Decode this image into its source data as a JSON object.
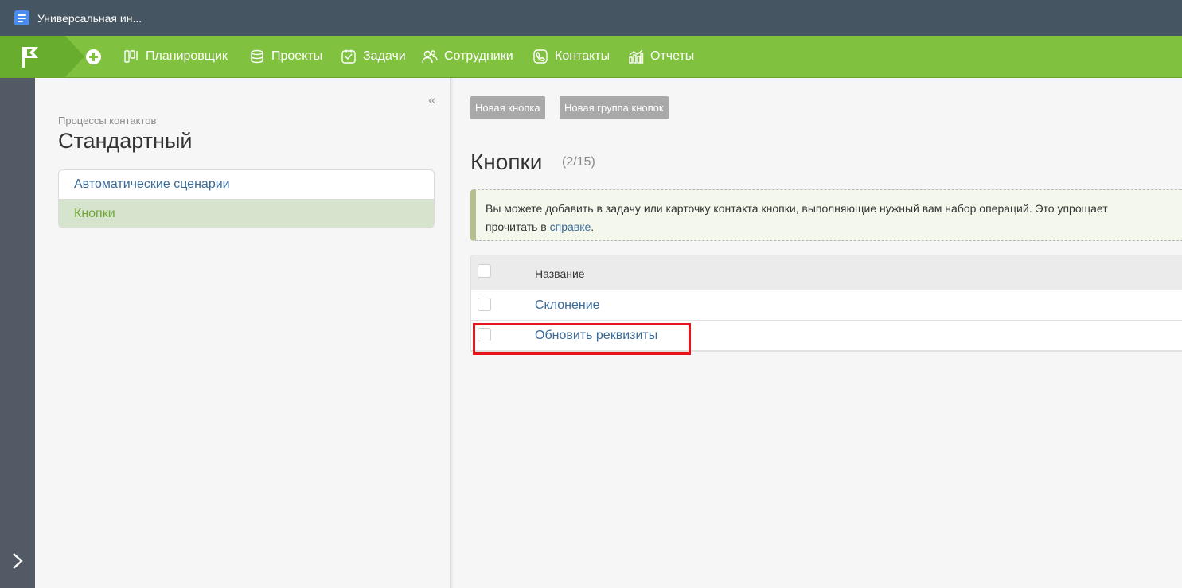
{
  "window": {
    "title": "Универсальная ин..."
  },
  "nav": {
    "items": [
      {
        "label": "Планировщик",
        "icon": "planner-icon"
      },
      {
        "label": "Проекты",
        "icon": "projects-icon"
      },
      {
        "label": "Задачи",
        "icon": "tasks-icon"
      },
      {
        "label": "Сотрудники",
        "icon": "employees-icon"
      },
      {
        "label": "Контакты",
        "icon": "contacts-icon"
      },
      {
        "label": "Отчеты",
        "icon": "reports-icon"
      }
    ]
  },
  "sidebar": {
    "subtitle": "Процессы контактов",
    "title": "Стандартный",
    "collapse_glyph": "«",
    "items": [
      {
        "label": "Автоматические сценарии",
        "active": false
      },
      {
        "label": "Кнопки",
        "active": true
      }
    ]
  },
  "main": {
    "buttons": {
      "new_button": "Новая кнопка",
      "new_group": "Новая группа кнопок"
    },
    "title": "Кнопки",
    "count": "(2/15)",
    "info": {
      "line1": "Вы можете добавить в задачу или карточку контакта кнопки, выполняющие нужный вам набор операций. Это упрощает",
      "line2_prefix": "прочитать в ",
      "link": "справке",
      "line2_suffix": "."
    },
    "table": {
      "header": "Название",
      "rows": [
        {
          "name": "Склонение"
        },
        {
          "name": "Обновить реквизиты"
        }
      ]
    }
  },
  "colors": {
    "nav_green": "#80c13f",
    "titlebar": "#455561",
    "highlight": "#e8141b",
    "link": "#3c6a96"
  }
}
